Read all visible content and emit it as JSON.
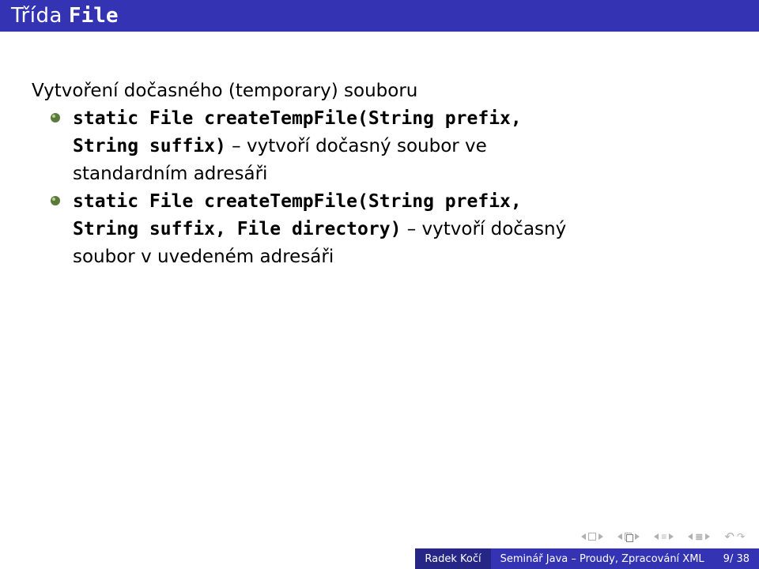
{
  "title": {
    "prefix": "Třída",
    "code": "File"
  },
  "content": {
    "heading": "Vytvoření dočasného (temporary) souboru",
    "items": [
      {
        "code": "static File createTempFile(String prefix,",
        "code2": "String suffix)",
        "text_sep": " – ",
        "text": "vytvoří dočasný soubor ve",
        "text2": "standardním adresáři"
      },
      {
        "code": "static File createTempFile(String prefix,",
        "code2": "String suffix, File directory)",
        "text_sep": " – ",
        "text": "vytvoří dočasný",
        "text2": "soubor v uvedeném adresáři"
      }
    ]
  },
  "footer": {
    "author": "Radek Kočí",
    "subject": "Seminář Java – Proudy, Zpracování XML",
    "page": "9/ 38"
  }
}
